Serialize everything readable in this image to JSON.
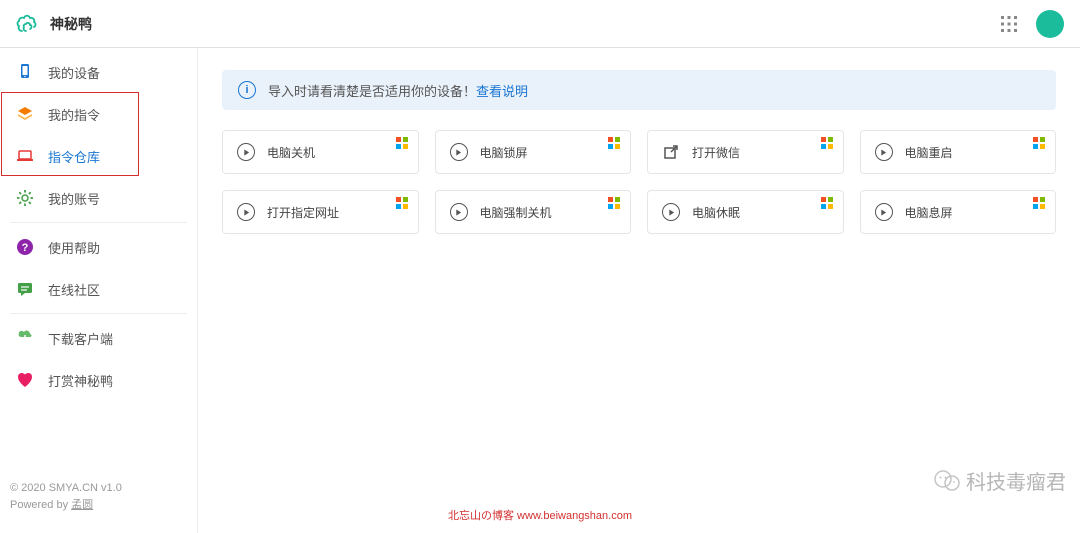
{
  "header": {
    "title": "神秘鸭"
  },
  "sidebar": {
    "items": [
      {
        "icon": "device",
        "label": "我的设备",
        "color": "#1976d2"
      },
      {
        "icon": "layers",
        "label": "我的指令",
        "color": "#f57c00"
      },
      {
        "icon": "laptop",
        "label": "指令仓库",
        "color": "#e53935",
        "active": true
      },
      {
        "icon": "gear",
        "label": "我的账号",
        "color": "#43a047"
      }
    ],
    "items2": [
      {
        "icon": "help",
        "label": "使用帮助",
        "color": "#8e24aa"
      },
      {
        "icon": "community",
        "label": "在线社区",
        "color": "#43a047"
      }
    ],
    "items3": [
      {
        "icon": "download",
        "label": "下载客户端",
        "color": "#66bb6a"
      },
      {
        "icon": "heart",
        "label": "打赏神秘鸭",
        "color": "#e91e63"
      }
    ]
  },
  "notice": {
    "text": "导入时请看清楚是否适用你的设备！",
    "link": "查看说明"
  },
  "cards": [
    {
      "label": "电脑关机",
      "icon": "play"
    },
    {
      "label": "电脑锁屏",
      "icon": "play"
    },
    {
      "label": "打开微信",
      "icon": "open"
    },
    {
      "label": "电脑重启",
      "icon": "play"
    },
    {
      "label": "打开指定网址",
      "icon": "play"
    },
    {
      "label": "电脑强制关机",
      "icon": "play"
    },
    {
      "label": "电脑休眠",
      "icon": "play"
    },
    {
      "label": "电脑息屏",
      "icon": "play"
    }
  ],
  "footer": {
    "line1": "© 2020 SMYA.CN v1.0",
    "line2_prefix": "Powered by ",
    "line2_link": "孟圆",
    "center_text": "北忘山の博客 ",
    "center_url": "www.beiwangshan.com"
  },
  "watermark": {
    "text": "科技毒瘤君"
  }
}
